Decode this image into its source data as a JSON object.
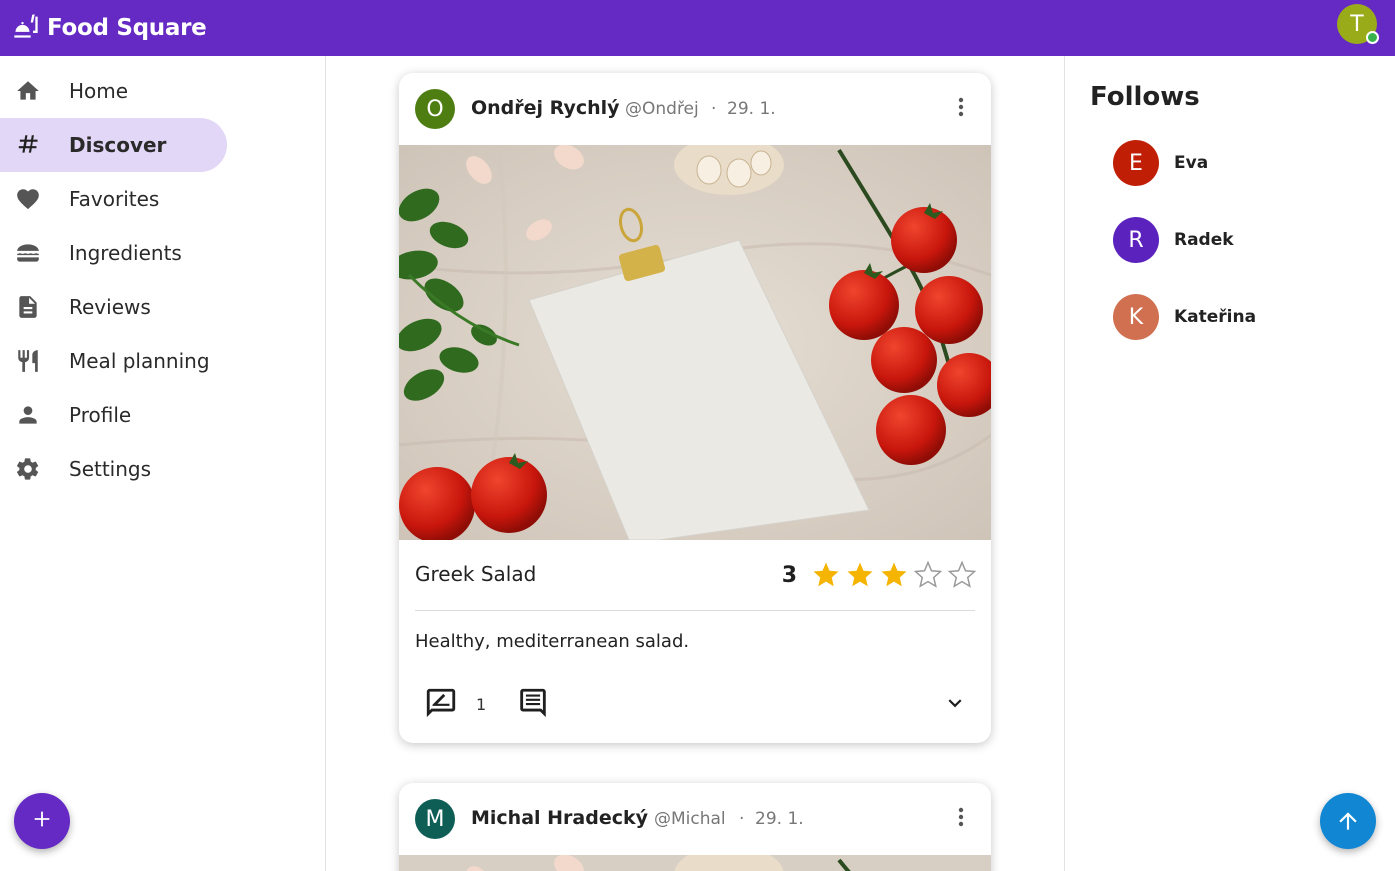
{
  "app": {
    "name": "Food Square",
    "logo_icon": "food-tray-icon"
  },
  "user": {
    "initial": "T",
    "avatar_color": "#9aab19",
    "status_color": "#37b24d"
  },
  "nav": {
    "items": [
      {
        "label": "Home",
        "icon": "home-icon",
        "active": false
      },
      {
        "label": "Discover",
        "icon": "hashtag-icon",
        "active": true
      },
      {
        "label": "Favorites",
        "icon": "heart-icon",
        "active": false
      },
      {
        "label": "Ingredients",
        "icon": "burger-icon",
        "active": false
      },
      {
        "label": "Reviews",
        "icon": "document-icon",
        "active": false
      },
      {
        "label": "Meal planning",
        "icon": "cutlery-icon",
        "active": false
      },
      {
        "label": "Profile",
        "icon": "person-icon",
        "active": false
      },
      {
        "label": "Settings",
        "icon": "gear-icon",
        "active": false
      }
    ],
    "add_button_icon": "plus-icon"
  },
  "feed": {
    "posts": [
      {
        "author_initial": "O",
        "author_color": "#4e7d12",
        "author_name": "Ondřej Rychlý",
        "handle": "@Ondřej",
        "separator": "·",
        "date": "29. 1.",
        "title": "Greek Salad",
        "rating": 3,
        "rating_max": 5,
        "description": "Healthy, mediterranean salad.",
        "review_count": "1"
      },
      {
        "author_initial": "M",
        "author_color": "#0f5e56",
        "author_name": "Michal Hradecký",
        "handle": "@Michal",
        "separator": "·",
        "date": "29. 1."
      }
    ]
  },
  "follows": {
    "title": "Follows",
    "items": [
      {
        "initial": "E",
        "name": "Eva",
        "color": "#c01e05"
      },
      {
        "initial": "R",
        "name": "Radek",
        "color": "#5c22be"
      },
      {
        "initial": "K",
        "name": "Kateřina",
        "color": "#d07050"
      }
    ]
  },
  "colors": {
    "primary": "#6529c4",
    "accent_blue": "#1187d4",
    "star": "#f5b400"
  }
}
